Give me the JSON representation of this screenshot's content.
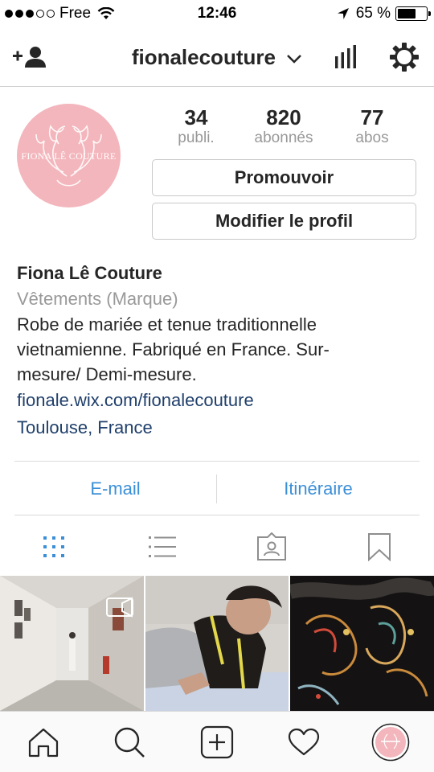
{
  "status_bar": {
    "carrier": "Free",
    "time": "12:46",
    "battery_percent": "65 %",
    "battery_level": 0.65,
    "signal_dots_filled": 3,
    "signal_dots_total": 5
  },
  "nav": {
    "username": "fionalecouture",
    "icons": [
      "add-user-icon",
      "chevron-down-icon",
      "stats-icon",
      "settings-gear-icon"
    ]
  },
  "profile": {
    "avatar_text": "FIONA LÊ COUTURE",
    "avatar_color": "#f3b6bc",
    "stats": [
      {
        "value": "34",
        "label": "publi."
      },
      {
        "value": "820",
        "label": "abonnés"
      },
      {
        "value": "77",
        "label": "abos"
      }
    ],
    "promote_label": "Promouvoir",
    "edit_label": "Modifier le profil"
  },
  "bio": {
    "name": "Fiona Lê Couture",
    "category": "Vêtements (Marque)",
    "lines": [
      "Robe de mariée et tenue traditionnelle",
      "vietnamienne. Fabriqué en France. Sur-",
      "mesure/ Demi-mesure."
    ],
    "website": "fionale.wix.com/fionalecouture",
    "location": "Toulouse, France"
  },
  "contact": {
    "email_label": "E-mail",
    "directions_label": "Itinéraire",
    "link_color": "#3b8fd8"
  },
  "view_tabs": [
    "grid-icon",
    "list-icon",
    "tagged-icon",
    "saved-icon"
  ],
  "tab_bar": [
    "home-icon",
    "search-icon",
    "new-post-icon",
    "activity-heart-icon",
    "profile-avatar-icon"
  ],
  "colors": {
    "text": "#262626",
    "muted": "#999999",
    "link": "#1f3f6b",
    "accent": "#3b8fd8"
  }
}
